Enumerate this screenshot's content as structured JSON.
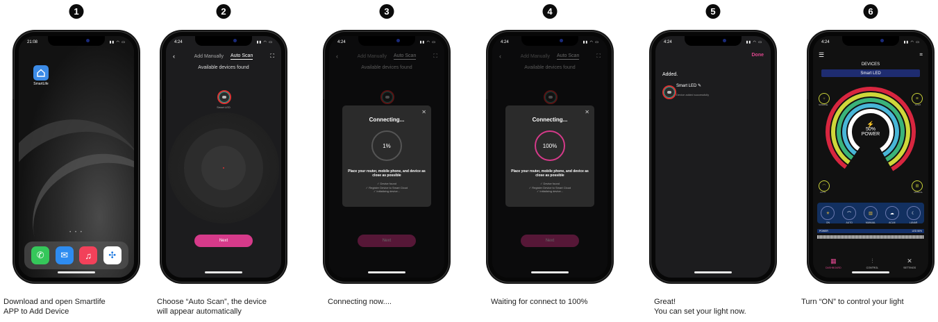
{
  "steps": [
    {
      "number": "1",
      "caption_lines": [
        "Download and open Smartlife",
        "APP to Add Device"
      ]
    },
    {
      "number": "2",
      "caption_lines": [
        "Choose “Auto Scan”, the device",
        "will appear automatically"
      ]
    },
    {
      "number": "3",
      "caption_lines": [
        "Connecting now...."
      ]
    },
    {
      "number": "4",
      "caption_lines": [
        "Waiting for connect to 100%"
      ]
    },
    {
      "number": "5",
      "caption_lines": [
        "Great!",
        "You can set your light now."
      ]
    },
    {
      "number": "6",
      "caption_lines": [
        "Turn “ON” to control your light"
      ]
    }
  ],
  "screen1": {
    "time": "21:08",
    "app_label": "SmartLife",
    "page_dots": "• • •"
  },
  "scan": {
    "time": "4:24",
    "tab_manual": "Add Manually",
    "tab_auto": "Auto Scan",
    "available": "Available devices found",
    "device_label": "Smart LED",
    "next_label": "Next",
    "connecting_title": "Connecting...",
    "hint": "Place your router, mobile phone, and device as close as possible",
    "checks": [
      "✓ Device found",
      "✓ Register Device to Smart Cloud",
      "✓ Initializing device..."
    ],
    "progress_3": "1%",
    "progress_4": "100%"
  },
  "screen5": {
    "done": "Done",
    "added": "Added.",
    "device": "Smart LED",
    "sub": "Device added successfully"
  },
  "screen6": {
    "header": "DEVICES",
    "device": "Smart LED",
    "power_pct": "50%",
    "power_word": "POWER",
    "corners": [
      "SUNRISE",
      "ACLM",
      "AUTO",
      "MANUAL"
    ],
    "modes": [
      "ON",
      "AUTO",
      "MANUAL",
      "ACLM",
      "LUNAR"
    ],
    "power_row_left": "POWER",
    "power_row_right": "LED 50%",
    "nav": [
      "DASHBOARD",
      "CONTROL",
      "SETTINGS"
    ]
  },
  "colors": {
    "accent_pink": "#d63a8a",
    "ring_colors": [
      "#d8263f",
      "#cfd73a",
      "#3ab37a",
      "#48b6d7",
      "#ffffff"
    ]
  }
}
